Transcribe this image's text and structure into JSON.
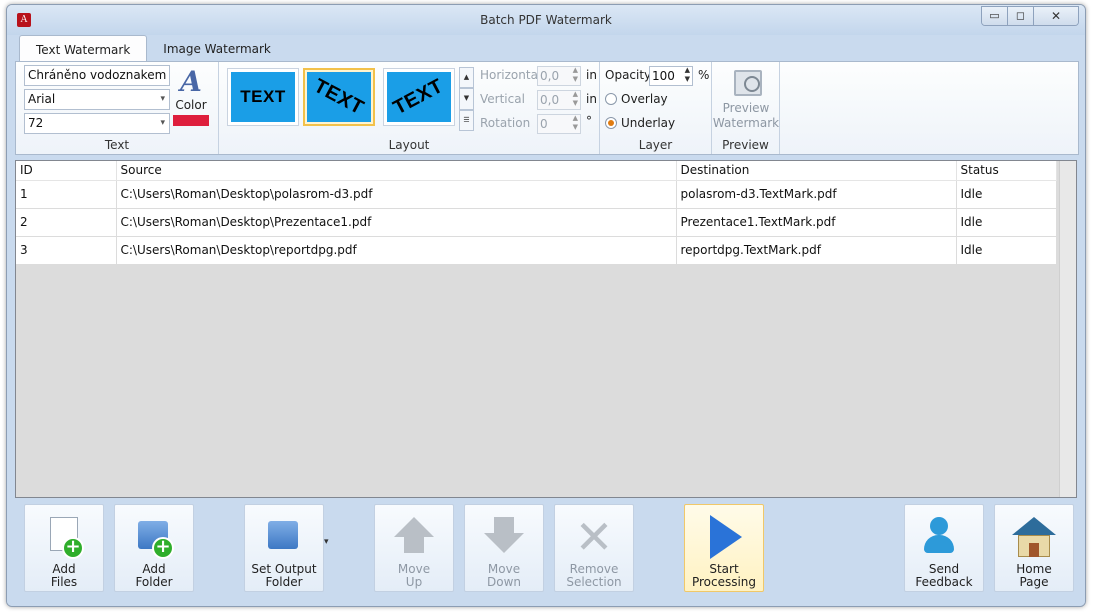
{
  "window": {
    "title": "Batch PDF Watermark",
    "minimize": "▭",
    "maximize": "◻",
    "close": "✕",
    "app_icon": "A"
  },
  "tabs": [
    "Text Watermark",
    "Image Watermark"
  ],
  "text_group": {
    "watermark_text": "Chráněno vodoznakem",
    "font": "Arial",
    "size": "72",
    "color_label": "Color",
    "color_value": "#de1e3c",
    "label": "Text"
  },
  "layout_group": {
    "presets": [
      "TEXT",
      "TEXT",
      "TEXT"
    ],
    "selected_index": 1,
    "horizontal_label": "Horizontal",
    "horizontal_value": "0,0",
    "horizontal_unit": "in",
    "vertical_label": "Vertical",
    "vertical_value": "0,0",
    "vertical_unit": "in",
    "rotation_label": "Rotation",
    "rotation_value": "0",
    "rotation_unit": "°",
    "label": "Layout"
  },
  "layer_group": {
    "opacity_label": "Opacity",
    "opacity_value": "100",
    "opacity_unit": "%",
    "overlay_label": "Overlay",
    "underlay_label": "Underlay",
    "selected": "Underlay",
    "label": "Layer"
  },
  "preview_group": {
    "button_line1": "Preview",
    "button_line2": "Watermark",
    "label": "Preview"
  },
  "grid": {
    "columns": [
      "ID",
      "Source",
      "Destination",
      "Status"
    ],
    "rows": [
      [
        "1",
        "C:\\Users\\Roman\\Desktop\\polasrom-d3.pdf",
        "polasrom-d3.TextMark.pdf",
        "Idle"
      ],
      [
        "2",
        "C:\\Users\\Roman\\Desktop\\Prezentace1.pdf",
        "Prezentace1.TextMark.pdf",
        "Idle"
      ],
      [
        "3",
        "C:\\Users\\Roman\\Desktop\\reportdpg.pdf",
        "reportdpg.TextMark.pdf",
        "Idle"
      ]
    ]
  },
  "toolbar": {
    "add_files": [
      "Add",
      "Files"
    ],
    "add_folder": [
      "Add",
      "Folder"
    ],
    "set_output": [
      "Set Output",
      "Folder"
    ],
    "move_up": [
      "Move",
      "Up"
    ],
    "move_down": [
      "Move",
      "Down"
    ],
    "remove": [
      "Remove",
      "Selection"
    ],
    "start": [
      "Start",
      "Processing"
    ],
    "feedback": [
      "Send",
      "Feedback"
    ],
    "home": [
      "Home",
      "Page"
    ]
  }
}
